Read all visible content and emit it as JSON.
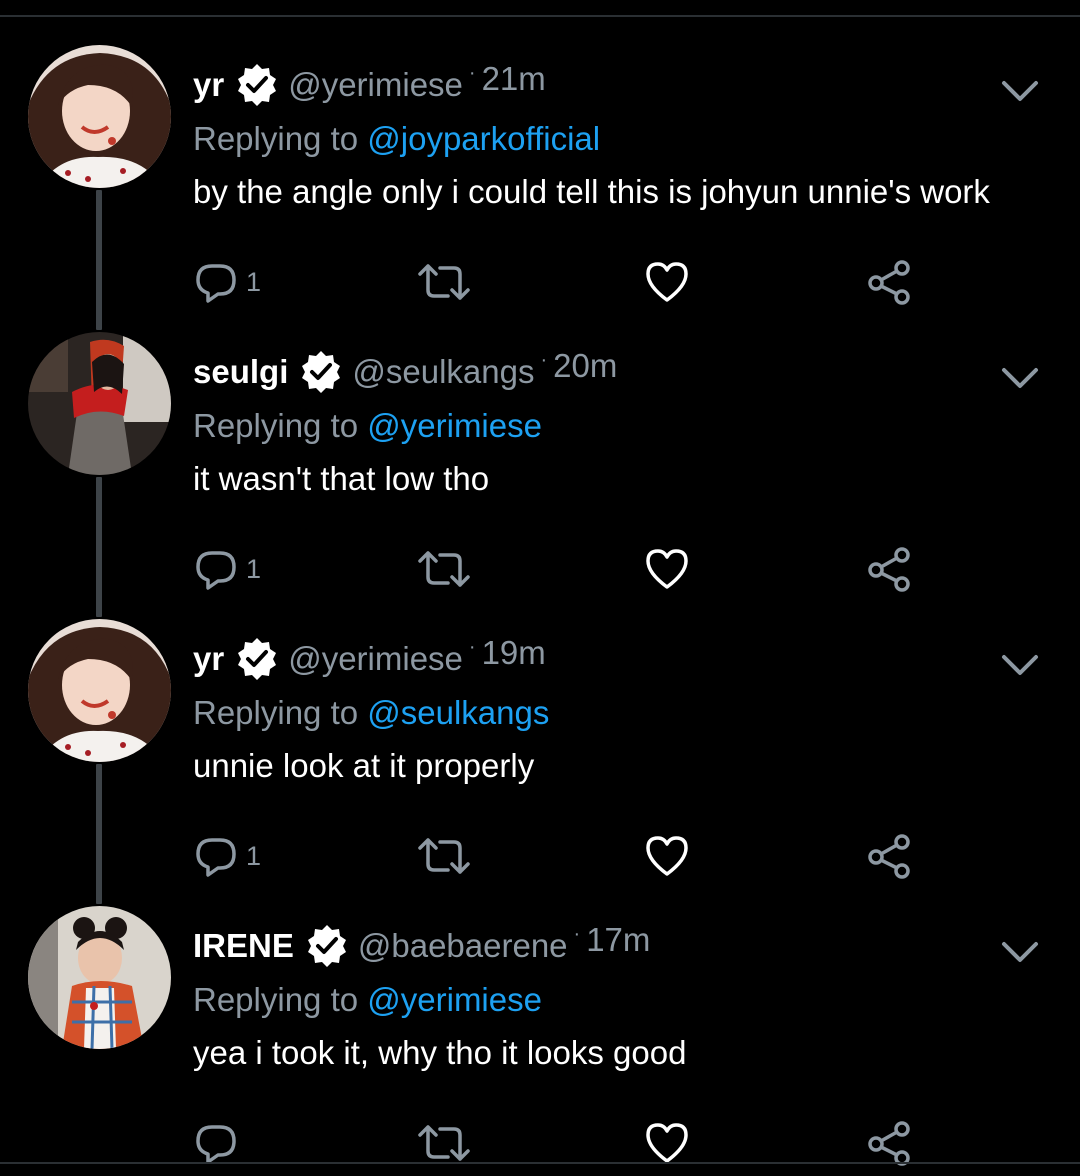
{
  "tweets": [
    {
      "display_name": "yr",
      "handle": "@yerimiese",
      "dot": "·",
      "time": "21m",
      "replying_prefix": "Replying to ",
      "replying_to": "@joyparkofficial",
      "text": "by the angle only i could tell this is johyun unnie's work",
      "reply_count": "1",
      "avatar": "yr-avatar"
    },
    {
      "display_name": "seulgi",
      "handle": "@seulkangs",
      "dot": "·",
      "time": "20m",
      "replying_prefix": "Replying to ",
      "replying_to": "@yerimiese",
      "text": "it wasn't that low tho",
      "reply_count": "1",
      "avatar": "seulgi-avatar"
    },
    {
      "display_name": "yr",
      "handle": "@yerimiese",
      "dot": "·",
      "time": "19m",
      "replying_prefix": "Replying to ",
      "replying_to": "@seulkangs",
      "text": "unnie look at it properly",
      "reply_count": "1",
      "avatar": "yr-avatar"
    },
    {
      "display_name": "IRENE",
      "handle": "@baebaerene",
      "dot": "·",
      "time": "17m",
      "replying_prefix": "Replying to ",
      "replying_to": "@yerimiese",
      "text": "yea i took it, why tho it looks good",
      "reply_count": "",
      "avatar": "irene-avatar"
    }
  ],
  "icons": {
    "reply": "reply-icon",
    "retweet": "retweet-icon",
    "like": "heart-icon",
    "share": "share-icon",
    "verified": "verified-badge-icon",
    "menu": "chevron-down-icon"
  },
  "colors": {
    "background": "#000000",
    "text": "#ffffff",
    "muted": "#8d98a2",
    "link": "#1da1f2",
    "thread_line": "#3d4348"
  }
}
